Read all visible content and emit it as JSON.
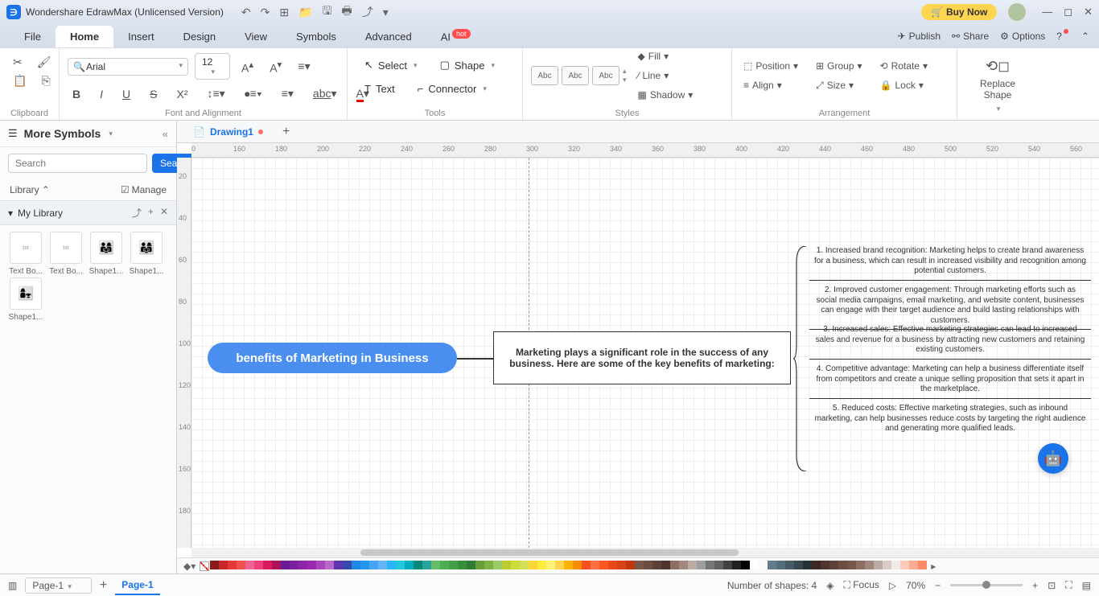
{
  "titlebar": {
    "app_name": "Wondershare EdrawMax (Unlicensed Version)",
    "buy_now": "Buy Now"
  },
  "menubar": {
    "tabs": [
      "File",
      "Home",
      "Insert",
      "Design",
      "View",
      "Symbols",
      "Advanced",
      "AI"
    ],
    "active": "Home",
    "hot": "hot",
    "publish": "Publish",
    "share": "Share",
    "options": "Options"
  },
  "ribbon": {
    "clipboard": "Clipboard",
    "font_align": "Font and Alignment",
    "tools": "Tools",
    "styles": "Styles",
    "arrangement": "Arrangement",
    "replace": "Replace",
    "font_name": "Arial",
    "font_size": "12",
    "select": "Select",
    "shape": "Shape",
    "text": "Text",
    "connector": "Connector",
    "abc": "Abc",
    "fill": "Fill",
    "line": "Line",
    "shadow": "Shadow",
    "position": "Position",
    "align": "Align",
    "group": "Group",
    "size": "Size",
    "rotate": "Rotate",
    "lock": "Lock",
    "replace_shape": "Replace\nShape"
  },
  "sidebar": {
    "more_symbols": "More Symbols",
    "search_placeholder": "Search",
    "search_btn": "Search",
    "library": "Library",
    "manage": "Manage",
    "my_library": "My Library",
    "shapes": [
      {
        "label": "Text Bo...",
        "type": "text"
      },
      {
        "label": "Text Bo...",
        "type": "text"
      },
      {
        "label": "Shape1...",
        "type": "people"
      },
      {
        "label": "Shape1...",
        "type": "people"
      },
      {
        "label": "Shape1...",
        "type": "people"
      }
    ]
  },
  "doc_tabs": {
    "active": "Drawing1"
  },
  "ruler_marks": [
    "0",
    "160",
    "180",
    "200",
    "220",
    "240",
    "260",
    "280",
    "300",
    "320",
    "340",
    "360",
    "380",
    "400",
    "420",
    "440",
    "460",
    "480",
    "500",
    "520",
    "540",
    "560"
  ],
  "ruler_v_marks": [
    "20",
    "40",
    "60",
    "80",
    "100",
    "120",
    "140",
    "160",
    "180"
  ],
  "diagram": {
    "central": "benefits of Marketing in Business",
    "intro": "Marketing plays a significant role in the success of any business. Here are some of the key benefits of marketing:",
    "benefits": [
      "1. Increased brand recognition: Marketing helps to create brand awareness for a business, which can result in increased visibility and recognition among potential customers.",
      "2. Improved customer engagement: Through marketing efforts such as social media campaigns, email marketing, and website content, businesses can engage with their target audience and build lasting relationships with customers.",
      "3. Increased sales: Effective marketing strategies can lead to increased sales and revenue for a business by attracting new customers and retaining existing customers.",
      "4. Competitive advantage: Marketing can help a business differentiate itself from competitors and create a unique selling proposition that sets it apart in the marketplace.",
      "5. Reduced costs: Effective marketing strategies, such as inbound marketing, can help businesses reduce costs by targeting the right audience and generating more qualified leads."
    ]
  },
  "statusbar": {
    "page_name": "Page-1",
    "page_tab": "Page-1",
    "shapes_count": "Number of shapes: 4",
    "focus": "Focus",
    "zoom": "70%"
  },
  "palette_colors": [
    "#8b1a1a",
    "#c62828",
    "#e53935",
    "#ef5350",
    "#f06292",
    "#ec407a",
    "#d81b60",
    "#ad1457",
    "#6a1b9a",
    "#7b1fa2",
    "#8e24aa",
    "#9c27b0",
    "#ab47bc",
    "#ba68c8",
    "#5e35b1",
    "#3949ab",
    "#1e88e5",
    "#2196f3",
    "#42a5f5",
    "#64b5f6",
    "#29b6f6",
    "#26c6da",
    "#00acc1",
    "#00897b",
    "#26a69a",
    "#66bb6a",
    "#4caf50",
    "#43a047",
    "#388e3c",
    "#2e7d32",
    "#689f38",
    "#7cb342",
    "#9ccc65",
    "#c0ca33",
    "#cddc39",
    "#d4e157",
    "#fdd835",
    "#ffeb3b",
    "#fff176",
    "#ffd54f",
    "#ffb300",
    "#fb8c00",
    "#f4511e",
    "#ff7043",
    "#ff5722",
    "#e64a19",
    "#d84315",
    "#bf360c",
    "#795548",
    "#6d4c41",
    "#5d4037",
    "#4e342e",
    "#8d6e63",
    "#a1887f",
    "#bcaaa4",
    "#9e9e9e",
    "#757575",
    "#616161",
    "#424242",
    "#212121",
    "#000000",
    "#ffffff",
    "#fafafa",
    "#607d8b",
    "#546e7a",
    "#455a64",
    "#37474f",
    "#263238",
    "#3e2723",
    "#4e342e",
    "#5d4037",
    "#6d4c41",
    "#795548",
    "#8d6e63",
    "#a1887f",
    "#bcaaa4",
    "#d7ccc8",
    "#efebe9",
    "#ffccbc",
    "#ffab91",
    "#ff8a65"
  ]
}
